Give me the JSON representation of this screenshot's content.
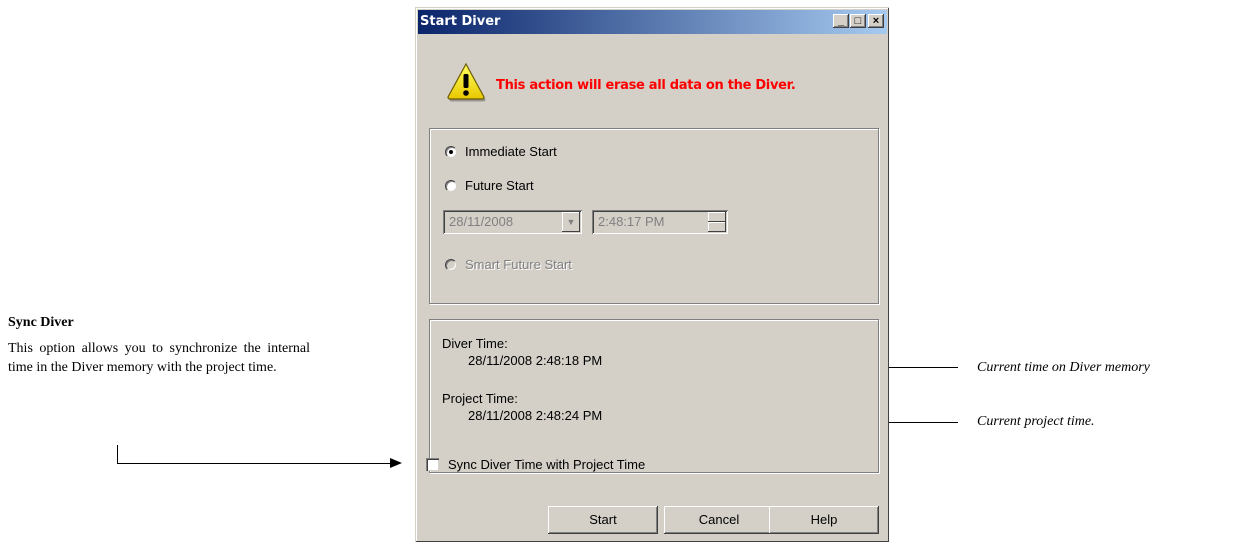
{
  "annotation": {
    "heading": "Sync Diver",
    "description": "This option allows you to synchronize the internal time in the Diver memory with the project time.",
    "notes": {
      "diver_time": "Current time on Diver memory",
      "project_time": "Current project time."
    }
  },
  "dialog": {
    "title": "Start Diver",
    "window_buttons": {
      "minimize": "_",
      "maximize": "□",
      "close": "×"
    },
    "warning": "This action will erase all data on the Diver.",
    "start_options": {
      "immediate": "Immediate Start",
      "future": "Future Start",
      "smart_future": "Smart Future Start",
      "selected": "immediate"
    },
    "future_date": "28/11/2008",
    "future_time": "2:48:17 PM",
    "times": {
      "diver_label": "Diver Time:",
      "diver_value": "28/11/2008 2:48:18 PM",
      "project_label": "Project Time:",
      "project_value": "28/11/2008 2:48:24 PM"
    },
    "sync_checkbox_label": "Sync Diver Time with Project Time",
    "sync_checked": false,
    "buttons": {
      "start": "Start",
      "cancel": "Cancel",
      "help": "Help"
    }
  },
  "colors": {
    "titlebar_start": "#0a246a",
    "titlebar_end": "#a6caf0",
    "warning_text": "#ff0000",
    "dialog_bg": "#d4d0c8"
  },
  "icons": {
    "warning": "warning-triangle-icon"
  }
}
